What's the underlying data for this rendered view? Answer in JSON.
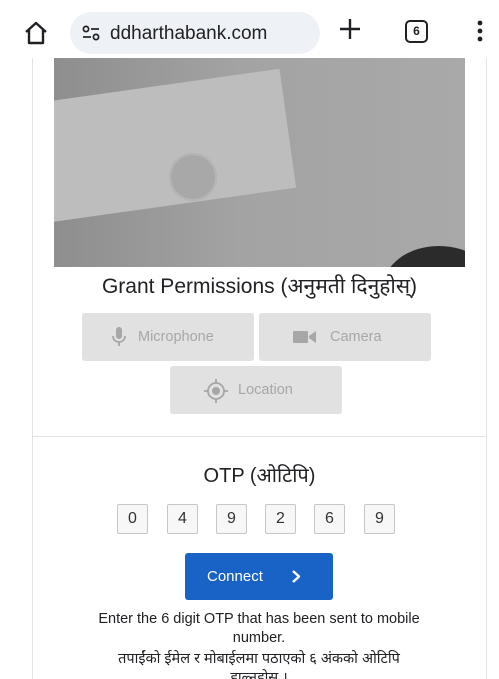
{
  "browser": {
    "url": "ddharthabank.com",
    "tab_count": "6",
    "icons": {
      "home": "home-icon",
      "site_settings": "tune-icon",
      "new_tab": "plus-icon",
      "tabs": "tab-switcher-icon",
      "menu": "kebab-menu-icon"
    }
  },
  "video": {
    "camera_button_icon": "videocam-icon"
  },
  "permissions": {
    "title": "Grant Permissions (अनुमती दिनुहोस्)",
    "microphone_label": "Microphone",
    "camera_label": "Camera",
    "location_label": "Location"
  },
  "otp": {
    "title": "OTP (ओटिपि)",
    "digits": [
      "0",
      "4",
      "9",
      "2",
      "6",
      "9"
    ]
  },
  "connect": {
    "label": "Connect",
    "arrow": "›"
  },
  "help": {
    "line1": "Enter the 6 digit OTP that has been sent to mobile",
    "line2": "number.",
    "line3": "तपाईंको ईमेल र मोबाईलमा पठाएको ६ अंकको ओटिपि",
    "line4": "हाल्नुहोस ।"
  },
  "colors": {
    "accent": "#1a63c6",
    "fab": "#2f80ed",
    "disabled_bg": "#e1e1e1",
    "disabled_text": "#a7a7a7"
  }
}
